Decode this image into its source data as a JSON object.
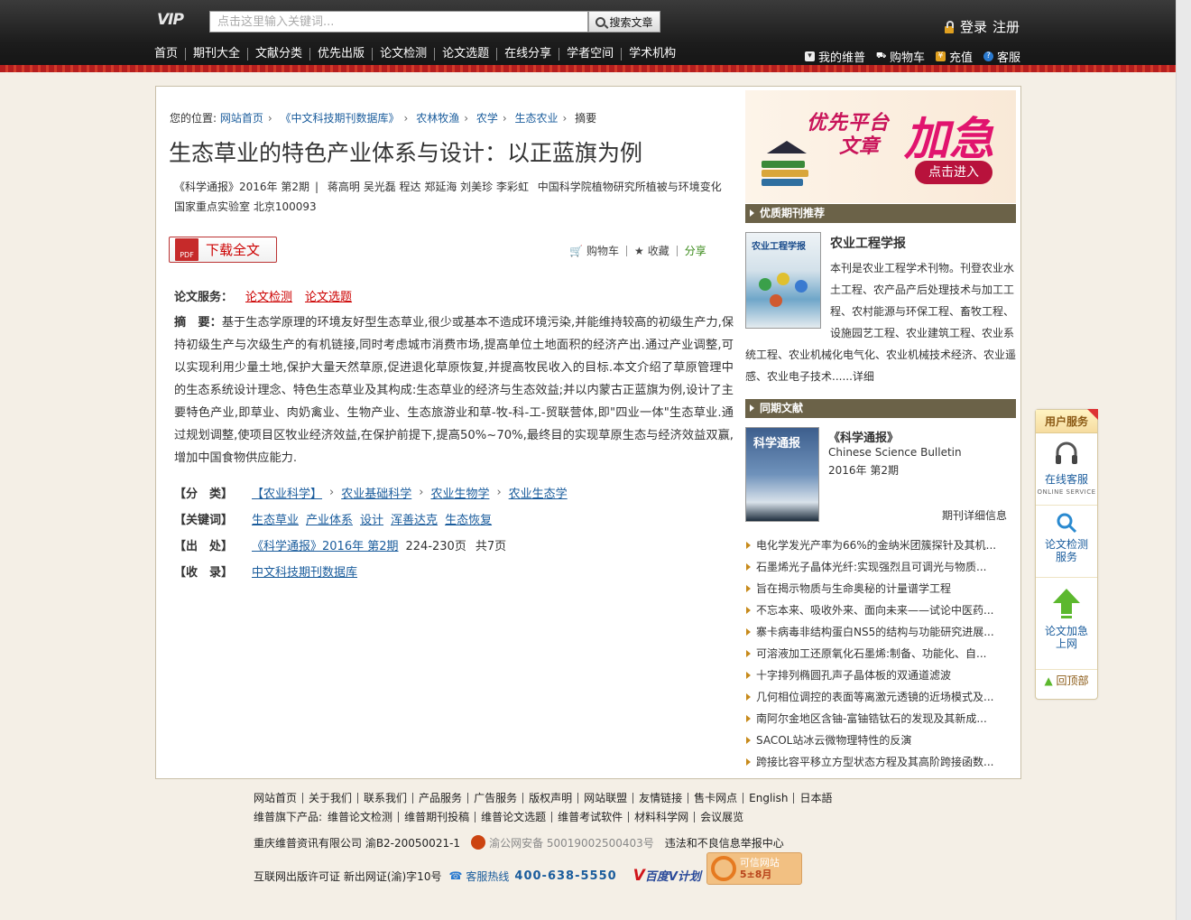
{
  "header": {
    "logo_text": "VIP",
    "search_placeholder": "点击这里输入关键词...",
    "search_button": "搜索文章",
    "login": "登录",
    "register": "注册",
    "nav": [
      "首页",
      "期刊大全",
      "文献分类",
      "优先出版",
      "论文检测",
      "论文选题",
      "在线分享",
      "学者空间",
      "学术机构"
    ],
    "user_nav": [
      "我的维普",
      "购物车",
      "充值",
      "客服"
    ]
  },
  "breadcrumb": {
    "prefix": "您的位置:",
    "items": [
      "网站首页",
      "《中文科技期刊数据库》",
      "农林牧渔",
      "农学",
      "生态农业"
    ],
    "current": "摘要"
  },
  "article": {
    "title": "生态草业的特色产业体系与设计：以正蓝旗为例",
    "journal": "《科学通报》2016年 第2期",
    "authors": "蒋高明 吴光磊 程达 郑延海 刘美珍 李彩虹",
    "affiliation": "中国科学院植物研究所植被与环境变化国家重点实验室 北京100093",
    "download_label": "下载全文",
    "pdf_label": "PDF",
    "actions": [
      "购物车",
      "收藏",
      "分享"
    ],
    "services_label": "论文服务：",
    "services": [
      "论文检测",
      "论文选题"
    ],
    "abstract_label": "摘　要：",
    "abstract": "基于生态学原理的环境友好型生态草业,很少或基本不造成环境污染,并能维持较高的初级生产力,保持初级生产与次级生产的有机链接,同时考虑城市消费市场,提高单位土地面积的经济产出.通过产业调整,可以实现利用少量土地,保护大量天然草原,促进退化草原恢复,并提高牧民收入的目标.本文介绍了草原管理中的生态系统设计理念、特色生态草业及其构成:生态草业的经济与生态效益;并以内蒙古正蓝旗为例,设计了主要特色产业,即草业、肉奶禽业、生物产业、生态旅游业和草-牧-科-工-贸联营体,即\"四业一体\"生态草业.通过规划调整,使项目区牧业经济效益,在保护前提下,提高50%~70%,最终目的实现草原生态与经济效益双赢,增加中国食物供应能力.",
    "category_label": "【分　类】",
    "categories": [
      "【农业科学】",
      "农业基础科学",
      "农业生物学",
      "农业生态学"
    ],
    "keywords_label": "【关键词】",
    "keywords": [
      "生态草业",
      "产业体系",
      "设计",
      "浑善达克",
      "生态恢复"
    ],
    "source_label": "【出　处】",
    "source_link": "《科学通报》2016年 第2期",
    "pages": "224-230页",
    "page_count": "共7页",
    "indexed_label": "【收　录】",
    "indexed": "中文科技期刊数据库"
  },
  "promo": {
    "line1": "优先平台",
    "line2": "文章",
    "big": "加急",
    "button": "点击进入"
  },
  "recommend": {
    "heading": "优质期刊推荐",
    "cover_text": "农业工程学报",
    "title": "农业工程学报",
    "desc": "本刊是农业工程学术刊物。刊登农业水土工程、农产品产后处理技术与加工工程、农村能源与环保工程、畜牧工程、设施园艺工程、农业建筑工程、农业系统工程、农业机械化电气化、农业机械技术经济、农业遥感、农业电子技术......",
    "more": "详细"
  },
  "current_issue": {
    "heading": "同期文献",
    "cover_text": "科学通报",
    "title": "《科学通报》",
    "english": "Chinese Science Bulletin",
    "issue": "2016年 第2期",
    "detail": "期刊详细信息",
    "articles": [
      "电化学发光产率为66%的金纳米团簇探针及其机...",
      "石墨烯光子晶体光纤:实现强烈且可调光与物质...",
      "旨在揭示物质与生命奥秘的计量谱学工程",
      "不忘本来、吸收外来、面向未来——试论中医药...",
      "寨卡病毒非结构蛋白NS5的结构与功能研究进展...",
      "可溶液加工还原氧化石墨烯:制备、功能化、自...",
      "十字排列椭圆孔声子晶体板的双通道滤波",
      "几何相位调控的表面等离激元透镜的近场模式及...",
      "南阿尔金地区含铀-富铀锆钛石的发现及其新成...",
      "SACOL站冰云微物理特性的反演",
      "跨接比容平移立方型状态方程及其高阶跨接函数..."
    ]
  },
  "float_panel": {
    "title": "用户服务",
    "online_service": "在线客服",
    "online_service_en": "ONLINE SERVICE",
    "check_l1": "论文检测",
    "check_l2": "服务",
    "fast_l1": "论文加急",
    "fast_l2": "上网",
    "back_top": "回顶部"
  },
  "footer": {
    "links": [
      "网站首页",
      "关于我们",
      "联系我们",
      "产品服务",
      "广告服务",
      "版权声明",
      "网站联盟",
      "友情链接",
      "售卡网点",
      "English",
      "日本語"
    ],
    "products_label": "维普旗下产品:",
    "products": [
      "维普论文检测",
      "维普期刊投稿",
      "维普论文选题",
      "维普考试软件",
      "材料科学网",
      "会议展览"
    ],
    "company": "重庆维普资讯有限公司 渝B2-20050021-1",
    "police": "渝公网安备 50019002500403号",
    "report": "违法和不良信息举报中心",
    "license": "互联网出版许可证 新出网证(渝)字10号",
    "hotline_label": "客服热线",
    "hotline": "400-638-5550",
    "baidu": "百度V计划",
    "trust_l1": "可信网站",
    "trust_l2": "5±8月"
  }
}
